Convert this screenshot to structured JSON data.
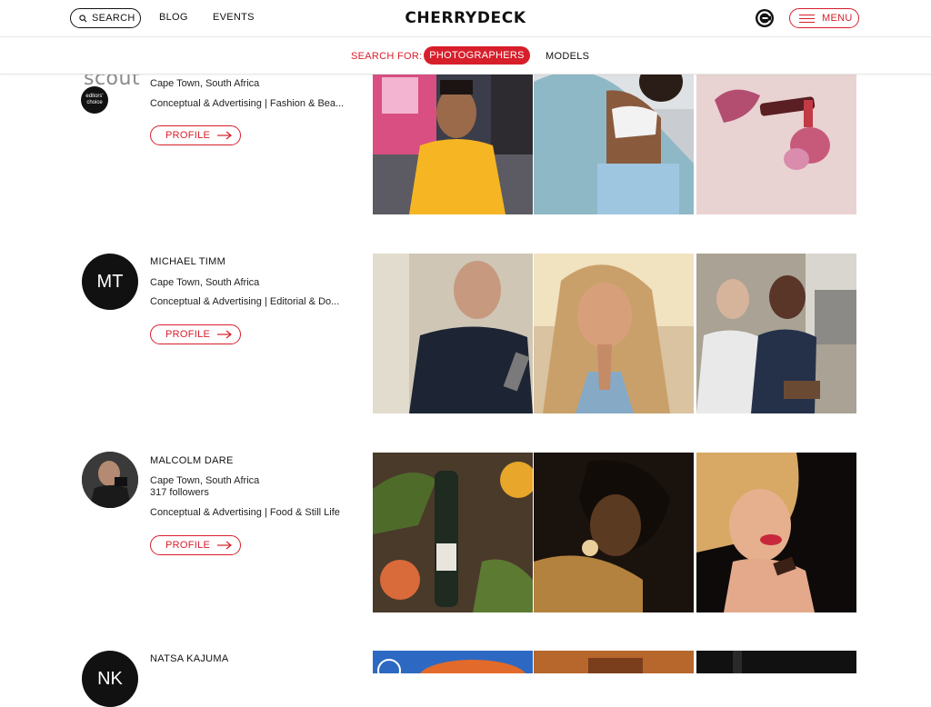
{
  "header": {
    "search_label": "SEARCH",
    "nav": [
      "BLOG",
      "EVENTS"
    ],
    "logo": "CHERRYDECK",
    "menu_label": "MENU"
  },
  "subnav": {
    "search_for": "SEARCH FOR:",
    "tabs": [
      "PHOTOGRAPHERS",
      "MODELS"
    ],
    "active_tab": "PHOTOGRAPHERS"
  },
  "profiles": [
    {
      "name": "",
      "logo_text": "scout",
      "badge_text": "editors' choice",
      "location": "Cape Town, South Africa",
      "categories": "Conceptual & Advertising | Fashion & Bea...",
      "button": "PROFILE"
    },
    {
      "name": "MICHAEL TIMM",
      "initials": "MT",
      "location": "Cape Town, South Africa",
      "categories": "Conceptual & Advertising | Editorial & Do...",
      "button": "PROFILE"
    },
    {
      "name": "MALCOLM DARE",
      "location": "Cape Town, South Africa",
      "followers": "317 followers",
      "categories": "Conceptual & Advertising | Food & Still Life",
      "button": "PROFILE"
    },
    {
      "name": "NATSA KAJUMA",
      "initials": "NK"
    }
  ],
  "colors": {
    "accent": "#d71e2b",
    "text": "#111111"
  }
}
